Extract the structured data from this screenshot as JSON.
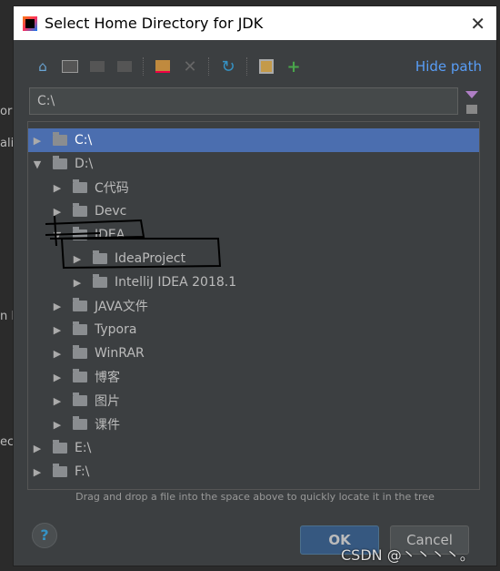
{
  "background": {
    "fragments": [
      "or",
      "ali",
      "n F",
      "ec"
    ]
  },
  "dialog": {
    "title": "Select Home Directory for JDK",
    "close_icon": "close-icon"
  },
  "toolbar": {
    "icons": [
      "home-icon",
      "desktop-icon",
      "project-folder-icon",
      "module-folder-icon",
      "new-folder-icon",
      "delete-icon",
      "refresh-icon",
      "show-hidden-icon",
      "add-jdk-icon"
    ],
    "hide_path": "Hide path"
  },
  "path": {
    "value": "C:\\"
  },
  "tree": {
    "rows": [
      {
        "label": "C:\\",
        "level": 0,
        "expanded": false,
        "selected": true
      },
      {
        "label": "D:\\",
        "level": 0,
        "expanded": true
      },
      {
        "label": "C代码",
        "level": 1,
        "expanded": false
      },
      {
        "label": "Devc",
        "level": 1,
        "expanded": false
      },
      {
        "label": "IDEA",
        "level": 1,
        "expanded": true
      },
      {
        "label": "IdeaProject",
        "level": 2,
        "expanded": false
      },
      {
        "label": "IntelliJ IDEA 2018.1",
        "level": 2,
        "expanded": false
      },
      {
        "label": "JAVA文件",
        "level": 1,
        "expanded": false
      },
      {
        "label": "Typora",
        "level": 1,
        "expanded": false
      },
      {
        "label": "WinRAR",
        "level": 1,
        "expanded": false
      },
      {
        "label": "博客",
        "level": 1,
        "expanded": false
      },
      {
        "label": "图片",
        "level": 1,
        "expanded": false
      },
      {
        "label": "课件",
        "level": 1,
        "expanded": false
      },
      {
        "label": "E:\\",
        "level": 0,
        "expanded": false
      },
      {
        "label": "F:\\",
        "level": 0,
        "expanded": false
      }
    ]
  },
  "hint": "Drag and drop a file into the space above to quickly locate it in the tree",
  "buttons": {
    "help": "?",
    "ok": "OK",
    "cancel": "Cancel"
  },
  "watermark": "CSDN @丶丶丶丶。",
  "colors": {
    "selection": "#4b6eaf",
    "link": "#589df6",
    "ok": "#365880"
  }
}
